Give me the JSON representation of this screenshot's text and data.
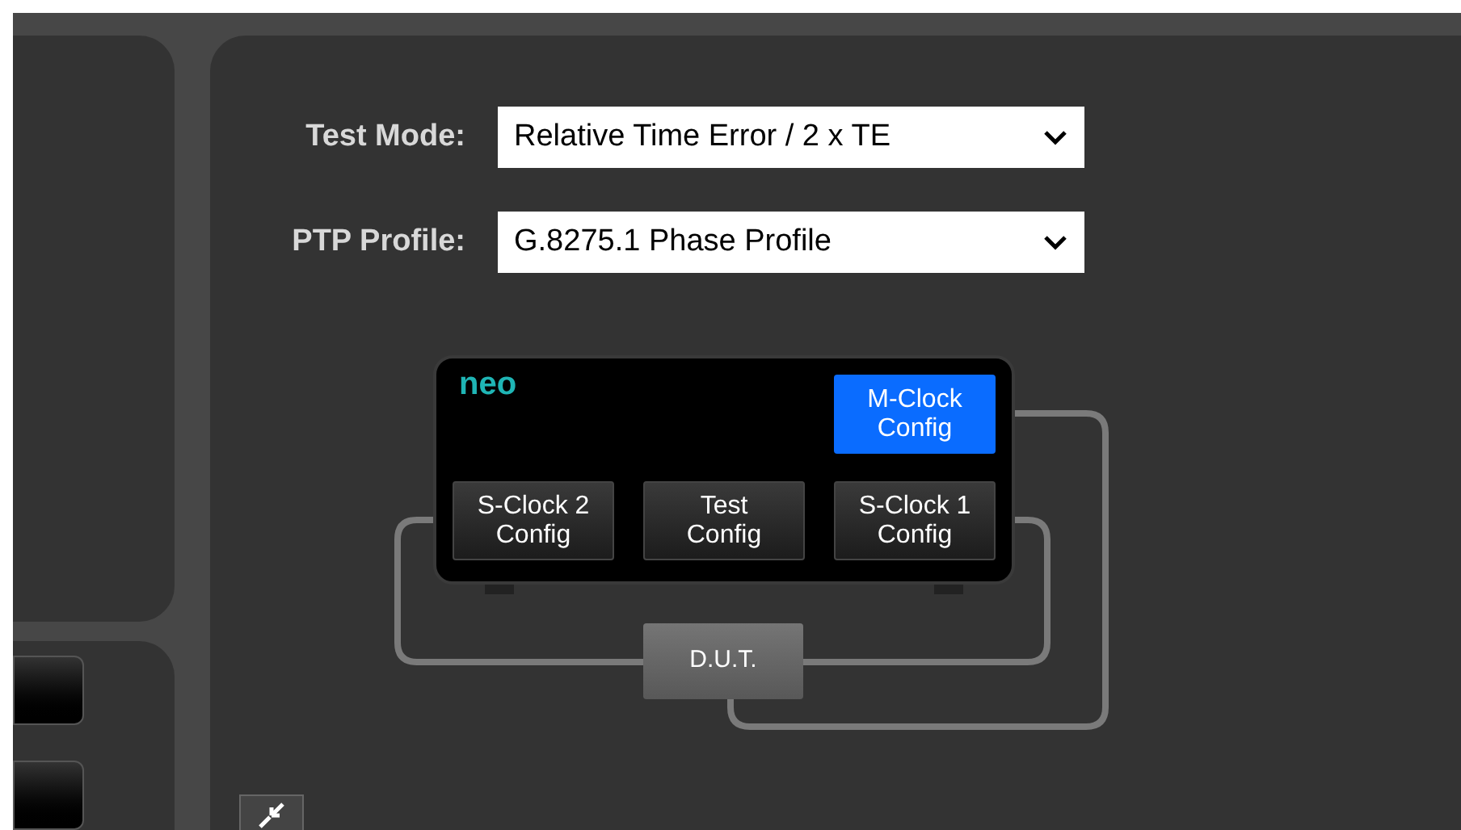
{
  "form": [
    {
      "label": "Test Mode:",
      "value": "Relative Time Error / 2 x TE"
    },
    {
      "label": "PTP Profile:",
      "value": "G.8275.1 Phase Profile"
    }
  ],
  "device": {
    "logo": "neo",
    "buttons": [
      {
        "label": "M-Clock\nConfig",
        "selected": true
      },
      {
        "label": "S-Clock 2\nConfig",
        "selected": false
      },
      {
        "label": "Test\nConfig",
        "selected": false
      },
      {
        "label": "S-Clock 1\nConfig",
        "selected": false
      }
    ]
  },
  "dut": {
    "label": "D.U.T."
  }
}
